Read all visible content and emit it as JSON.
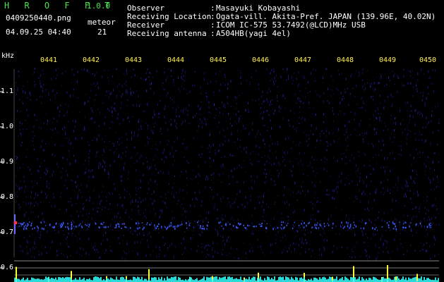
{
  "app": {
    "title": "H R O F F T",
    "version": "1.0.0",
    "file": "0409250440.png",
    "timestamp": "04.09.25 04:40",
    "meteor_label": "meteor",
    "meteor_count": "21"
  },
  "info": [
    {
      "label": "Observer",
      "colon": ":",
      "value": "Masayuki Kobayashi"
    },
    {
      "label": "Receiving Location",
      "colon": ":",
      "value": "Ogata-vill. Akita-Pref. JAPAN (139.96E, 40.02N)"
    },
    {
      "label": "Receiver",
      "colon": ":",
      "value": "ICOM IC-575 53.7492(@LCD)MHz USB"
    },
    {
      "label": "Receiving antenna",
      "colon": ":",
      "value": "A504HB(yagi 4el)"
    }
  ],
  "axis": {
    "y_unit": "kHz",
    "y_ticks": [
      "1.1",
      "1.0",
      "0.9",
      "0.8",
      "0.7"
    ],
    "x_ticks": [
      "0441",
      "0442",
      "0443",
      "0444",
      "0445",
      "0446",
      "0447",
      "0448",
      "0449",
      "0450"
    ],
    "bottom_tick": "0.6"
  },
  "colors": {
    "background": "#000000",
    "title": "#48e648",
    "tick_label": "#ffee55",
    "noise": "#1c1c8c",
    "echo": "#3b5bff",
    "meteor_marker": "#ff3355",
    "bars_yellow": "#ffff33",
    "bars_cyan": "#33ffff"
  }
}
